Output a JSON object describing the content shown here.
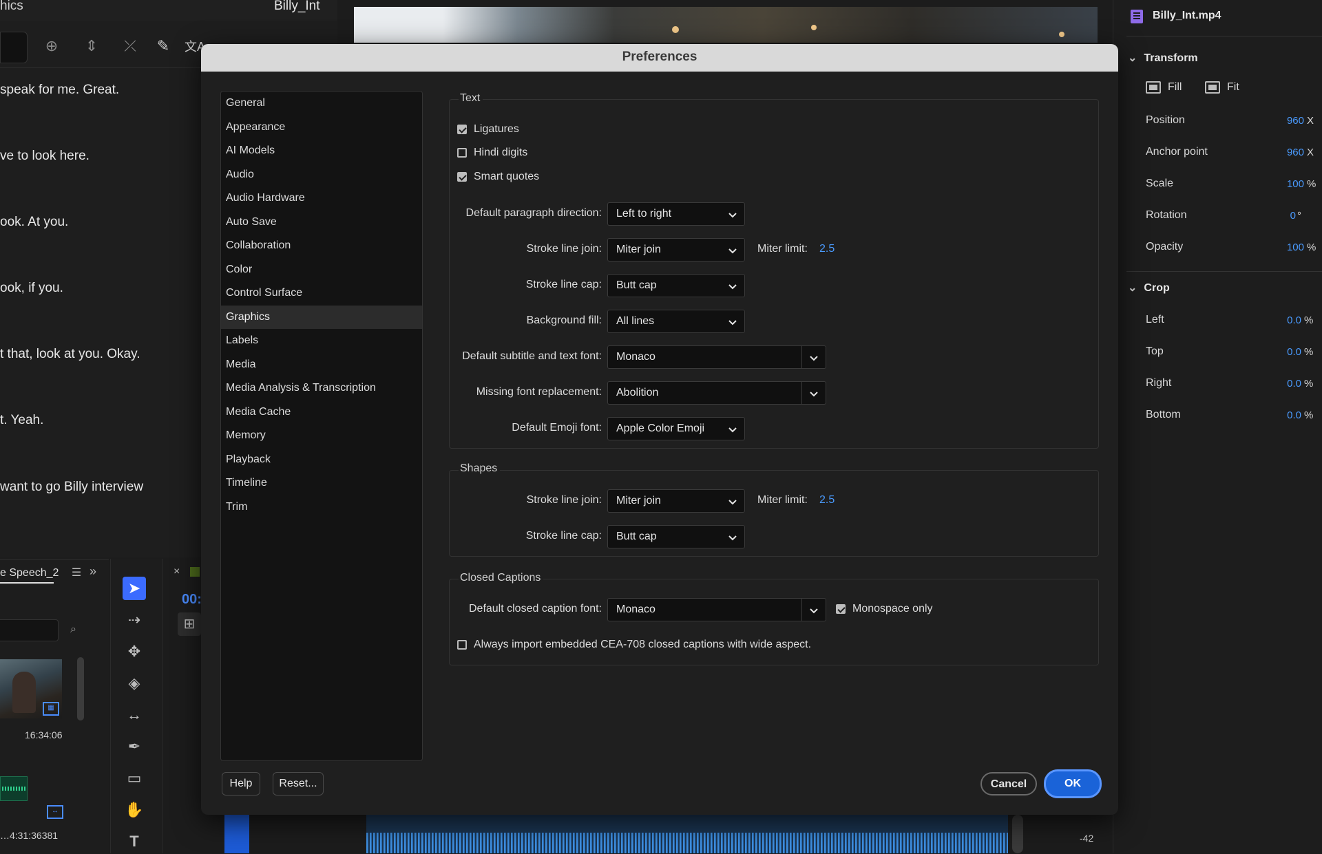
{
  "left_panel": {
    "title_left": "hics",
    "title_right": "Billy_Int",
    "transcript": [
      "speak for me. Great.",
      "ve to look here.",
      "ook. At you.",
      "ook, if you.",
      "t that, look at you. Okay.",
      "t. Yeah.",
      " want to go Billy interview"
    ]
  },
  "project_panel": {
    "tab_label": "e Speech_2",
    "clip_duration": "16:34:06",
    "audio_duration": "4:31:36381"
  },
  "timeline": {
    "timecode": "00:",
    "meter_value": "-42"
  },
  "effect_controls": {
    "clip_name": "Billy_Int.mp4",
    "transform_label": "Transform",
    "fill_label": "Fill",
    "fit_label": "Fit",
    "transform_props": [
      {
        "label": "Position",
        "value": "960",
        "unit": "X"
      },
      {
        "label": "Anchor point",
        "value": "960",
        "unit": "X"
      },
      {
        "label": "Scale",
        "value": "100",
        "unit": "%"
      },
      {
        "label": "Rotation",
        "value": "0",
        "unit": "°"
      },
      {
        "label": "Opacity",
        "value": "100",
        "unit": "%"
      }
    ],
    "crop_label": "Crop",
    "crop_props": [
      {
        "label": "Left",
        "value": "0.0",
        "unit": "%"
      },
      {
        "label": "Top",
        "value": "0.0",
        "unit": "%"
      },
      {
        "label": "Right",
        "value": "0.0",
        "unit": "%"
      },
      {
        "label": "Bottom",
        "value": "0.0",
        "unit": "%"
      }
    ]
  },
  "dialog": {
    "title": "Preferences",
    "nav": [
      "General",
      "Appearance",
      "AI Models",
      "Audio",
      "Audio Hardware",
      "Auto Save",
      "Collaboration",
      "Color",
      "Control Surface",
      "Graphics",
      "Labels",
      "Media",
      "Media Analysis & Transcription",
      "Media Cache",
      "Memory",
      "Playback",
      "Timeline",
      "Trim"
    ],
    "selected_nav": "Graphics",
    "text_section": {
      "legend": "Text",
      "ligatures": {
        "label": "Ligatures",
        "checked": true
      },
      "hindi_digits": {
        "label": "Hindi digits",
        "checked": false
      },
      "smart_quotes": {
        "label": "Smart quotes",
        "checked": true
      },
      "paragraph_direction": {
        "label": "Default paragraph direction:",
        "value": "Left to right"
      },
      "stroke_join": {
        "label": "Stroke line join:",
        "value": "Miter join",
        "miter_label": "Miter limit:",
        "miter_value": "2.5"
      },
      "stroke_cap": {
        "label": "Stroke line cap:",
        "value": "Butt cap"
      },
      "background_fill": {
        "label": "Background fill:",
        "value": "All lines"
      },
      "subtitle_font": {
        "label": "Default subtitle and text font:",
        "value": "Monaco"
      },
      "missing_font": {
        "label": "Missing font replacement:",
        "value": "Abolition"
      },
      "emoji_font": {
        "label": "Default Emoji font:",
        "value": "Apple Color Emoji"
      }
    },
    "shapes_section": {
      "legend": "Shapes",
      "stroke_join": {
        "label": "Stroke line join:",
        "value": "Miter join",
        "miter_label": "Miter limit:",
        "miter_value": "2.5"
      },
      "stroke_cap": {
        "label": "Stroke line cap:",
        "value": "Butt cap"
      }
    },
    "captions_section": {
      "legend": "Closed Captions",
      "caption_font": {
        "label": "Default closed caption font:",
        "value": "Monaco"
      },
      "monospace_only": {
        "label": "Monospace only",
        "checked": true
      },
      "cea708": {
        "label": "Always import embedded CEA-708 closed captions with wide aspect.",
        "checked": false
      }
    },
    "buttons": {
      "help": "Help",
      "reset": "Reset...",
      "cancel": "Cancel",
      "ok": "OK"
    }
  },
  "colors": {
    "accent_blue": "#4a9bff",
    "ok_button": "#1a63d8",
    "dialog_bg": "#1f1f1f",
    "titlebar_bg": "#d9d9d9"
  }
}
